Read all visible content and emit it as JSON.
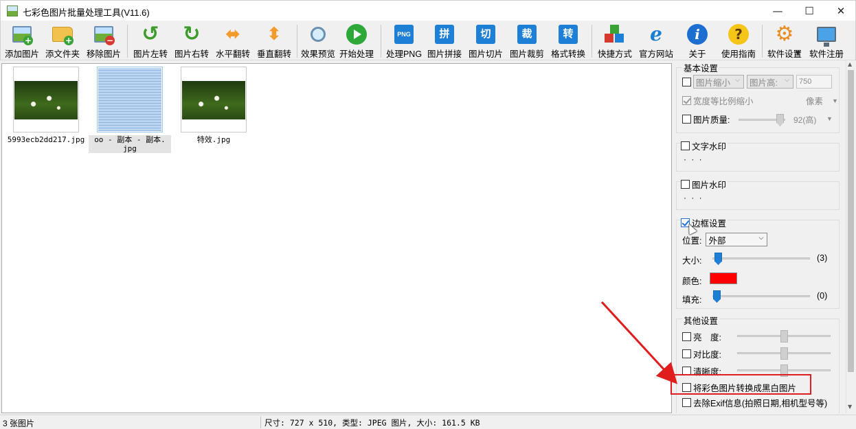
{
  "window": {
    "title": "七彩色图片批量处理工具(V11.6)",
    "minimize_symbol": "—",
    "maximize_symbol": "☐",
    "close_symbol": "✕"
  },
  "toolbar": {
    "items": [
      {
        "label": "添加图片",
        "icon": "add-image-icon"
      },
      {
        "label": "添文件夹",
        "icon": "add-folder-icon"
      },
      {
        "label": "移除图片",
        "icon": "remove-image-icon"
      },
      {
        "label": "图片左转",
        "icon": "rotate-left-icon"
      },
      {
        "label": "图片右转",
        "icon": "rotate-right-icon"
      },
      {
        "label": "水平翻转",
        "icon": "flip-horizontal-icon"
      },
      {
        "label": "垂直翻转",
        "icon": "flip-vertical-icon"
      },
      {
        "label": "效果预览",
        "icon": "magnifier-icon"
      },
      {
        "label": "开始处理",
        "icon": "play-icon"
      },
      {
        "label": "处理PNG",
        "icon": "png-icon",
        "glyph": "PNG"
      },
      {
        "label": "图片拼接",
        "icon": "stitch-icon",
        "glyph": "拼"
      },
      {
        "label": "图片切片",
        "icon": "slice-icon",
        "glyph": "切"
      },
      {
        "label": "图片裁剪",
        "icon": "crop-icon",
        "glyph": "裁"
      },
      {
        "label": "格式转换",
        "icon": "convert-icon",
        "glyph": "转"
      },
      {
        "label": "快捷方式",
        "icon": "shortcut-cubes-icon"
      },
      {
        "label": "官方网站",
        "icon": "ie-browser-icon"
      },
      {
        "label": "关于",
        "icon": "info-icon"
      },
      {
        "label": "使用指南",
        "icon": "help-icon"
      },
      {
        "label": "软件设置",
        "icon": "gear-icon"
      },
      {
        "label": "软件注册",
        "icon": "monitor-icon"
      }
    ]
  },
  "thumbnails": [
    {
      "name": "5993ecb2dd217.jpg",
      "name_line2": "",
      "kind": "photo",
      "selected": false
    },
    {
      "name": "oo - 副本 - 副本.",
      "name_line2": "jpg",
      "kind": "document",
      "selected": true
    },
    {
      "name": "特效.jpg",
      "name_line2": "",
      "kind": "photo",
      "selected": false
    }
  ],
  "settings": {
    "basic": {
      "title": "基本设置",
      "resize_select": "图片缩小",
      "height_select": "图片高:",
      "height_value": "750",
      "keep_ratio_label": "宽度等比例缩小",
      "unit_select": "像素",
      "quality_label": "图片质量:",
      "quality_value": "92(高)"
    },
    "text_watermark": {
      "title": "文字水印",
      "dots": "· · ·"
    },
    "image_watermark": {
      "title": "图片水印",
      "dots": "· · ·"
    },
    "border": {
      "title": "边框设置",
      "checked": true,
      "position_label": "位置:",
      "position_value": "外部",
      "size_label": "大小:",
      "size_value": "(3)",
      "color_label": "颜色:",
      "color_hex": "#ff0000",
      "fill_label": "填充:",
      "fill_value": "(0)"
    },
    "other": {
      "title": "其他设置",
      "brightness_label": "亮　度:",
      "contrast_label": "对比度:",
      "sharpness_label": "清晰度:",
      "grayscale_label": "将彩色图片转换成黑白图片",
      "exif_label": "去除Exif信息(拍照日期,相机型号等)"
    }
  },
  "status": {
    "count": "3 张图片",
    "info": "尺寸: 727 x 510, 类型: JPEG 图片, 大小: 161.5 KB"
  },
  "colors": {
    "accent": "#1e7fd6",
    "highlight": "#e01c1c",
    "border_color": "#ff0000"
  }
}
